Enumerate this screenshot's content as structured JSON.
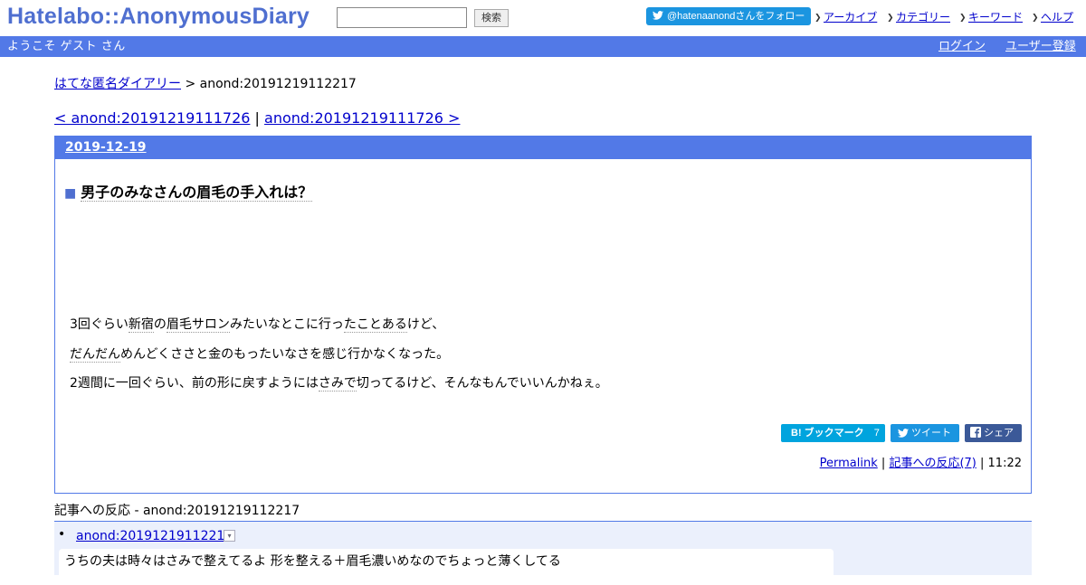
{
  "header": {
    "logo": "Hatelabo::AnonymousDiary",
    "search_value": "",
    "search_button": "検索",
    "follow_label": "@hatenaanondさんをフォロー",
    "nav": [
      "アーカイブ",
      "カテゴリー",
      "キーワード",
      "ヘルプ"
    ]
  },
  "userbar": {
    "welcome": "ようこそ ゲスト さん",
    "login": "ログイン",
    "register": "ユーザー登録"
  },
  "breadcrumb": {
    "home": "はてな匿名ダイアリー",
    "separator": ">",
    "current": "anond:20191219112217"
  },
  "pager": {
    "prev": "< anond:20191219111726",
    "separator": "|",
    "next": "anond:20191219111726 >"
  },
  "day": {
    "date": "2019-12-19",
    "title_marker": "■",
    "title": "男子のみなさんの眉毛の手入れは？",
    "body": {
      "line1_a": "3回ぐらい",
      "line1_kw1": "新宿",
      "line1_b": "の",
      "line1_kw2": "眉毛サロン",
      "line1_c": "みたいなとこに行っ",
      "line1_kw3": "たことある",
      "line1_d": "けど、",
      "line2_kw": "だんだん",
      "line2_rest": "めんどくささと金のもったいなさを感じ行かなくなった。",
      "line3_a": "2週間に一回ぐらい、前の形に戻すようには",
      "line3_kw": "さみで",
      "line3_b": "切ってるけど、そんなもんでいいんかねぇ。"
    },
    "share": {
      "bookmark_label": "ブックマーク",
      "bookmark_count": "7",
      "tweet_label": "ツイート",
      "facebook_label": "シェア"
    },
    "footer": {
      "permalink": "Permalink",
      "sep": "|",
      "reactions_link": "記事への反応(7)",
      "time": "11:22"
    }
  },
  "reactions": {
    "title": "記事への反応 - anond:20191219112217",
    "items": [
      {
        "bullet": "•",
        "link": "anond:20191219112217",
        "toggle": "▾",
        "text": "うちの夫は時々はさみで整えてるよ 形を整える＋眉毛濃いめなのでちょっと薄くしてる"
      }
    ]
  }
}
